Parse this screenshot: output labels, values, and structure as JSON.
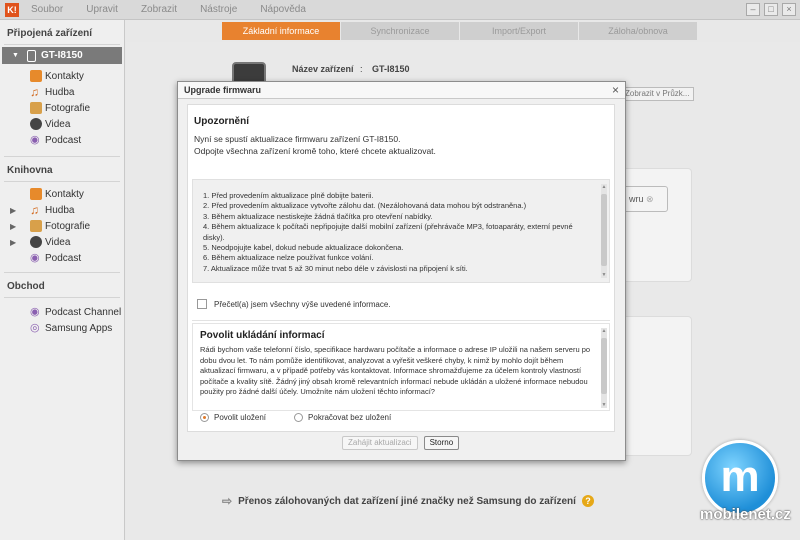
{
  "menubar": {
    "logo": "K!",
    "items": [
      "Soubor",
      "Upravit",
      "Zobrazit",
      "Nástroje",
      "Nápověda"
    ],
    "window_controls": [
      "minimize-icon",
      "maximize-icon",
      "close-icon"
    ]
  },
  "sidebar": {
    "connected_title": "Připojená zařízení",
    "device_name": "GT-I8150",
    "device_items": [
      "Kontakty",
      "Hudba",
      "Fotografie",
      "Videa",
      "Podcast"
    ],
    "library_title": "Knihovna",
    "library_items": [
      "Kontakty",
      "Hudba",
      "Fotografie",
      "Videa",
      "Podcast"
    ],
    "store_title": "Obchod",
    "store_items": [
      "Podcast Channel",
      "Samsung Apps"
    ]
  },
  "tabs": [
    {
      "label": "Základní informace",
      "active": true
    },
    {
      "label": "Synchronizace",
      "active": false
    },
    {
      "label": "Import/Export",
      "active": false
    },
    {
      "label": "Záloha/obnova",
      "active": false
    }
  ],
  "main": {
    "device_name_label": "Název zařízení",
    "device_name_colon": ":",
    "device_name_value": "GT-I8150",
    "show_in_explorer_button": "Zobrazit v Průzk...",
    "side_button": "wru",
    "footer_text": "Přenos zálohovaných dat zařízení jiné značky než Samsung do zařízení"
  },
  "dialog": {
    "title": "Upgrade firmwaru",
    "warning_heading": "Upozornění",
    "warning_line1": "Nyní se spustí aktualizace firmwaru zařízení GT-I8150.",
    "warning_line2": "Odpojte všechna zařízení kromě toho, které chcete aktualizovat.",
    "instructions": [
      "1. Před provedením aktualizace plně dobijte baterii.",
      "2. Před provedením aktualizace vytvořte zálohu dat. (Nezálohovaná data mohou být odstraněna.)",
      "3. Během aktualizace nestiskejte žádná tlačítka pro otevření nabídky.",
      "4. Během aktualizace k počítači nepřipojujte další mobilní zařízení (přehrávače MP3, fotoaparáty, externí pevné disky).",
      "5. Neodpojujte kabel, dokud nebude aktualizace dokončena.",
      "6. Během aktualizace nelze používat funkce volání.",
      "7. Aktualizace může trvat 5 až 30 minut nebo déle v závislosti na připojení k síti."
    ],
    "checkbox_label": "Přečetl(a) jsem všechny výše uvedené informace.",
    "share_heading": "Povolit ukládání informací",
    "share_text": "Rádi bychom vaše telefonní číslo, specifikace hardwaru počítače a informace o adrese IP uložili na našem serveru po dobu dvou let. To nám pomůže identifikovat, analyzovat a vyřešit veškeré chyby, k nimž by mohlo dojít během aktualizací firmwaru, a v případě potřeby vás kontaktovat. Informace shromažďujeme za účelem kontroly vlastností počítače a kvality sítě. Žádný jiný obsah kromě relevantních informací nebude ukládán a uložené informace nebudou použity pro žádné další účely. Umožníte nám uložení těchto informací?",
    "radio_allow": "Povolit uložení",
    "radio_continue": "Pokračovat bez uložení",
    "start_button": "Zahájit aktualizaci",
    "cancel_button": "Storno"
  },
  "watermark": {
    "logo_letter": "m",
    "text": "mobilenet.cz"
  }
}
